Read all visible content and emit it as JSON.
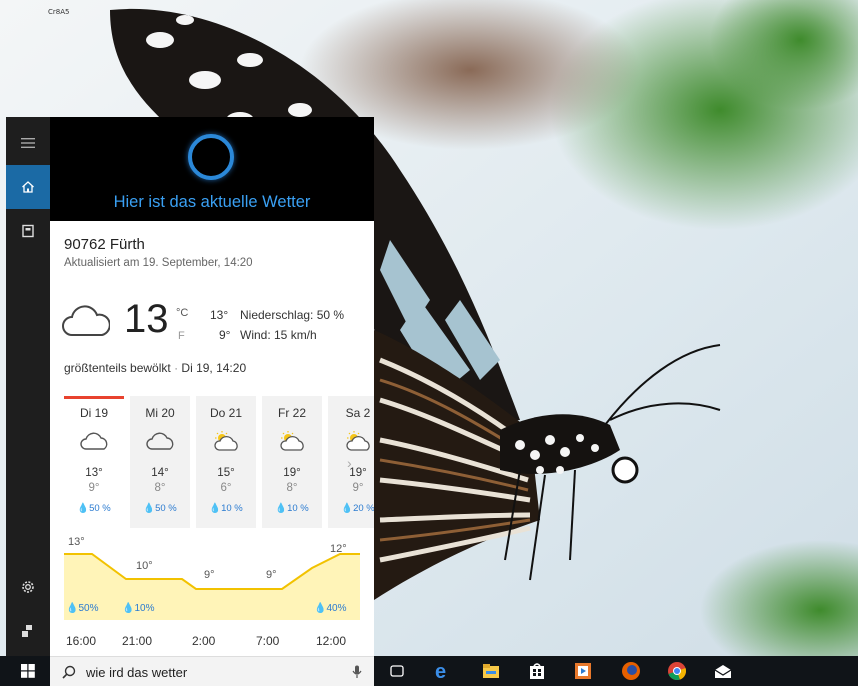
{
  "desktop": {
    "tiny_label": "Cr8A5"
  },
  "cortana": {
    "heading": "Hier ist das aktuelle Wetter",
    "rail": [
      "hamburger-icon",
      "home-icon",
      "notebook-icon",
      "settings-icon",
      "feedback-icon"
    ]
  },
  "weather": {
    "location": "90762 Fürth",
    "updated": "Aktualisiert am 19. September, 14:20",
    "current_temp": "13",
    "unit_c": "°C",
    "unit_f": "F",
    "high": "13°",
    "low": "9°",
    "precip": "Niederschlag: 50 %",
    "wind": "Wind: 15 km/h",
    "condition": "größtenteils bewölkt",
    "condition_sep": "·",
    "condition_time": "Di 19, 14:20",
    "days": [
      {
        "name": "Di 19",
        "icon": "cloud-icon",
        "hi": "13°",
        "lo": "9°",
        "precip": "50 %"
      },
      {
        "name": "Mi 20",
        "icon": "cloud-icon",
        "hi": "14°",
        "lo": "8°",
        "precip": "50 %"
      },
      {
        "name": "Do 21",
        "icon": "partly-sunny-icon",
        "hi": "15°",
        "lo": "6°",
        "precip": "10 %"
      },
      {
        "name": "Fr 22",
        "icon": "partly-sunny-icon",
        "hi": "19°",
        "lo": "8°",
        "precip": "10 %"
      },
      {
        "name": "Sa 2",
        "icon": "partly-sunny-icon",
        "hi": "19°",
        "lo": "9°",
        "precip": "20 %"
      }
    ],
    "hourly": {
      "times": [
        "16:00",
        "21:00",
        "2:00",
        "7:00",
        "12:00"
      ],
      "temps": [
        "13°",
        "10°",
        "9°",
        "9°",
        "12°"
      ],
      "precip": [
        "50%",
        "10%",
        "40%"
      ]
    }
  },
  "search": {
    "query": "wie ird das wetter"
  },
  "taskbar": [
    "task-view-icon",
    "edge-icon",
    "file-explorer-icon",
    "store-icon",
    "media-player-icon",
    "firefox-icon",
    "chrome-icon",
    "mail-icon"
  ],
  "colors": {
    "accent": "#1b6aa5",
    "cortana_blue": "#3aa0f3",
    "precip_blue": "#2b7bd0",
    "selected_day": "#e8422e",
    "graph_fill": "#fff4b8",
    "graph_line": "#f2c200"
  }
}
